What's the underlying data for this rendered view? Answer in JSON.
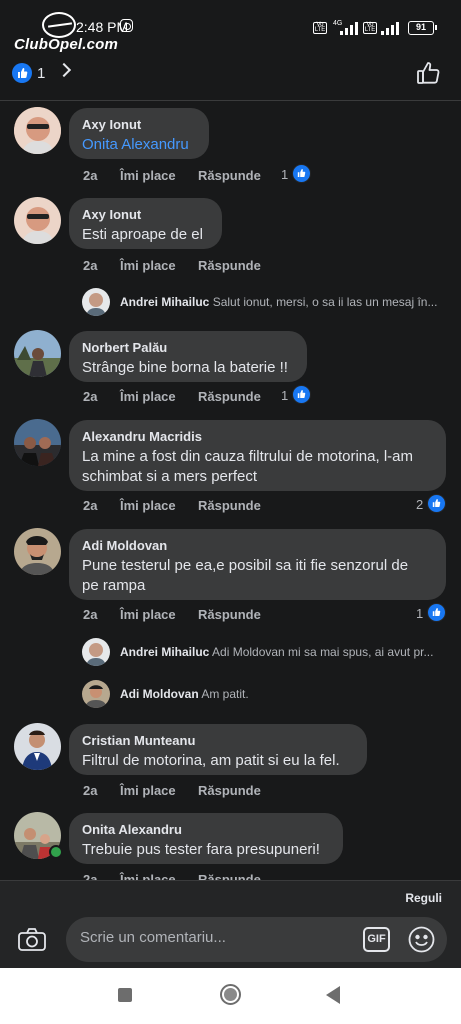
{
  "status_bar": {
    "time": "2:48 PM",
    "network": "4G",
    "volte": "Vo LTE",
    "battery": "91"
  },
  "watermark": "ClubOpel.com",
  "header": {
    "like_count": "1"
  },
  "actions": {
    "age": "2a",
    "like": "Îmi place",
    "reply": "Răspunde"
  },
  "comments": [
    {
      "author": "Axy Ionut",
      "text": "Onita Alexandru",
      "reactions": "1"
    },
    {
      "author": "Axy Ionut",
      "text": "Esti aproape de el",
      "reactions": ""
    },
    {
      "author": "Norbert Palău",
      "text": "Strânge bine borna la baterie !!",
      "reactions": "1"
    },
    {
      "author": "Alexandru Macridis",
      "text_line1": "La mine a fost din cauza filtrului de motorina, l-am",
      "text_line2": "schimbat si a mers perfect",
      "reactions": "2"
    },
    {
      "author": "Adi Moldovan",
      "text_line1": "Pune testerul pe ea,e posibil sa iti fie senzorul de",
      "text_line2": "pe rampa",
      "reactions": "1"
    },
    {
      "author": "Cristian Munteanu",
      "text": "Filtrul de motorina, am patit si eu la fel.",
      "reactions": ""
    },
    {
      "author": "Onita Alexandru",
      "text": "Trebuie pus tester fara presupuneri!",
      "reactions": ""
    }
  ],
  "replies": [
    {
      "author": "Andrei Mihailuc",
      "text": "Salut ionut, mersi, o sa ii las un mesaj în..."
    },
    {
      "author": "Andrei Mihailuc",
      "text": "Adi Moldovan mi sa mai spus, ai avut pr..."
    },
    {
      "author": "Adi Moldovan",
      "text": "Am patit."
    }
  ],
  "composer": {
    "rules_label": "Reguli",
    "placeholder": "Scrie un comentariu...",
    "gif_label": "GIF"
  },
  "colors": {
    "background": "#18191a",
    "bubble": "#3a3b3c",
    "accent": "#1877f2",
    "mention": "#4599ff",
    "muted_text": "#b0b3b8"
  }
}
